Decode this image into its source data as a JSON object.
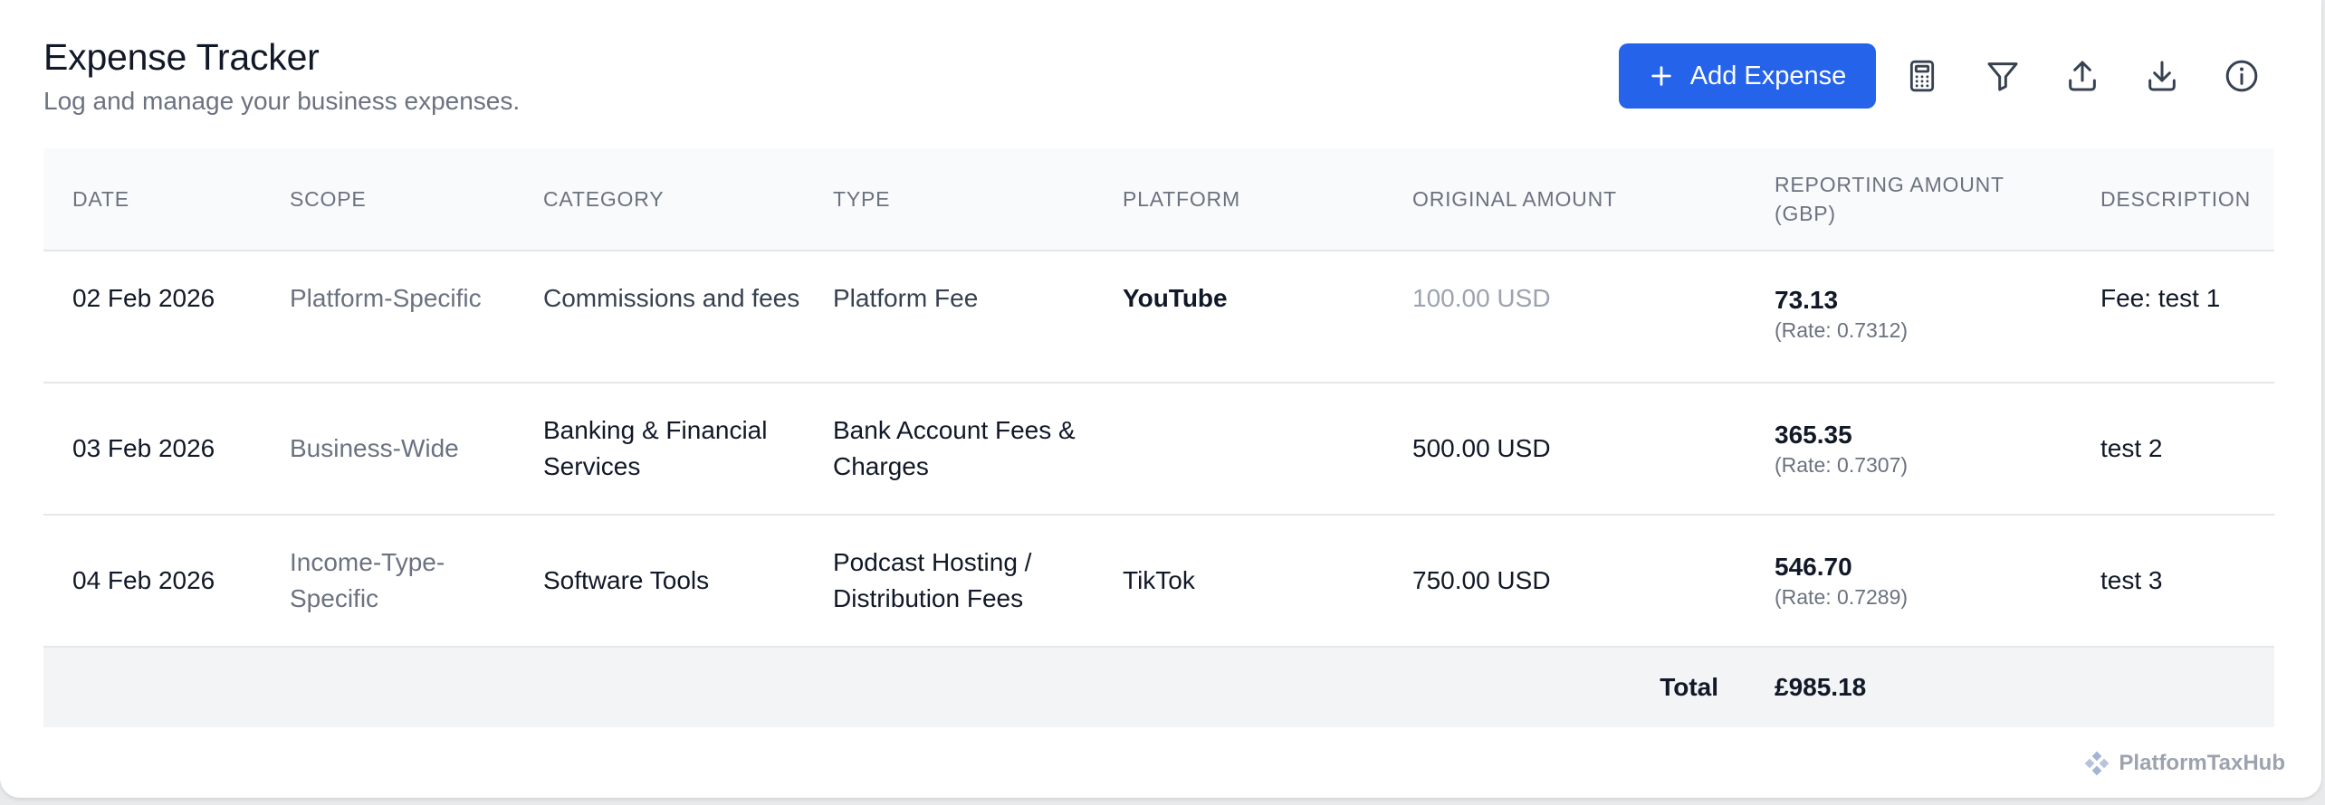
{
  "header": {
    "title": "Expense Tracker",
    "subtitle": "Log and manage your business expenses."
  },
  "toolbar": {
    "add_label": "Add Expense",
    "icons": [
      "calculator-icon",
      "filter-icon",
      "upload-icon",
      "download-icon",
      "info-icon"
    ],
    "accent_color": "#2563eb"
  },
  "table": {
    "columns": [
      "DATE",
      "SCOPE",
      "CATEGORY",
      "TYPE",
      "PLATFORM",
      "ORIGINAL AMOUNT",
      "REPORTING AMOUNT (GBP)",
      "DESCRIPTION"
    ],
    "rows": [
      {
        "date": "02 Feb 2026",
        "scope": "Platform-Specific",
        "category": "Commissions and fees",
        "type": "Platform Fee",
        "platform": "YouTube",
        "original": "100.00 USD",
        "reporting": "73.13",
        "rate": "(Rate: 0.7312)",
        "description": "Fee: test 1"
      },
      {
        "date": "03 Feb 2026",
        "scope": "Business-Wide",
        "category": "Banking & Financial Services",
        "type": "Bank Account Fees & Charges",
        "platform": "",
        "original": "500.00 USD",
        "reporting": "365.35",
        "rate": "(Rate: 0.7307)",
        "description": "test 2"
      },
      {
        "date": "04 Feb 2026",
        "scope": "Income-Type-Specific",
        "category": "Software Tools",
        "type": "Podcast Hosting / Distribution Fees",
        "platform": "TikTok",
        "original": "750.00 USD",
        "reporting": "546.70",
        "rate": "(Rate: 0.7289)",
        "description": "test 3"
      }
    ],
    "total_label": "Total",
    "total_value": "£985.18"
  },
  "footer": {
    "brand": "PlatformTaxHub"
  }
}
